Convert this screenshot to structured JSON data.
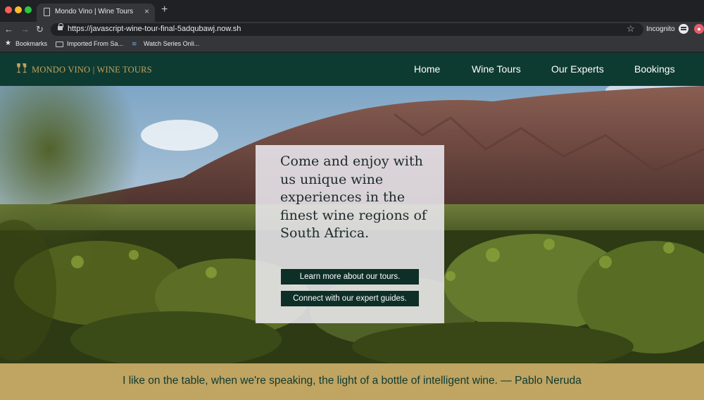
{
  "browser": {
    "tab_title": "Mondo Vino | Wine Tours",
    "tab_close": "×",
    "new_tab": "+",
    "url": "https://javascript-wine-tour-final-5adqubawj.now.sh",
    "incognito_label": "Incognito",
    "bookmarks": [
      {
        "label": "Bookmarks",
        "icon": "star-icon"
      },
      {
        "label": "Imported From Sa...",
        "icon": "folder-icon"
      },
      {
        "label": "Watch Series Onli...",
        "icon": "site-icon"
      }
    ]
  },
  "site": {
    "logo_text": "MONDO VINO | WINE TOURS",
    "logo_icon": "wine-glasses-icon",
    "nav": [
      {
        "label": "Home"
      },
      {
        "label": "Wine Tours"
      },
      {
        "label": "Our Experts"
      },
      {
        "label": "Bookings"
      }
    ]
  },
  "hero": {
    "headline": "Come and enjoy with us unique wine experiences in the finest wine regions of South Africa.",
    "buttons": [
      {
        "label": "Learn more about our tours."
      },
      {
        "label": "Connect with our expert guides."
      }
    ]
  },
  "quote": {
    "text": "I like on the table, when we're speaking, the light of a bottle of intelligent wine. — Pablo Neruda"
  },
  "colors": {
    "header_bg": "#0e3b31",
    "logo_gold": "#c5a15e",
    "quote_bar": "#c0a462",
    "button_bg": "#0d2f27"
  }
}
